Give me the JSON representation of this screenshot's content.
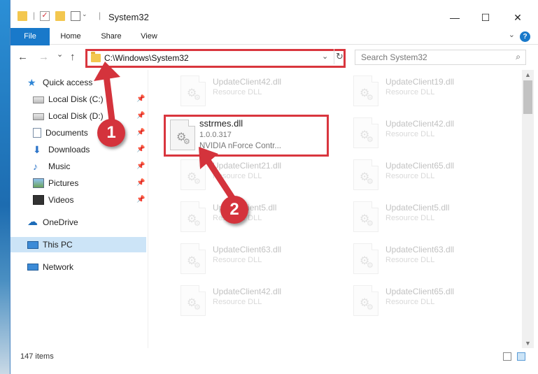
{
  "window": {
    "title": "System32",
    "controls": {
      "minimize": "—",
      "maximize": "☐",
      "close": "✕"
    }
  },
  "ribbon": {
    "tabs": [
      "File",
      "Home",
      "Share",
      "View"
    ],
    "help": "?"
  },
  "navigation": {
    "back_icon": "←",
    "forward_icon": "→",
    "recent_icon": "⌄",
    "up_icon": "↑",
    "address_path": "C:\\Windows\\System32",
    "search_placeholder": "Search System32"
  },
  "sidebar": {
    "items": [
      {
        "label": "Quick access",
        "icon": "star-icon",
        "pinned": false
      },
      {
        "label": "Local Disk (C:)",
        "icon": "disk-icon",
        "pinned": true
      },
      {
        "label": "Local Disk (D:)",
        "icon": "disk-icon",
        "pinned": true
      },
      {
        "label": "Documents",
        "icon": "documents-icon",
        "pinned": true
      },
      {
        "label": "Downloads",
        "icon": "downloads-icon",
        "pinned": true
      },
      {
        "label": "Music",
        "icon": "music-icon",
        "pinned": true
      },
      {
        "label": "Pictures",
        "icon": "pictures-icon",
        "pinned": true
      },
      {
        "label": "Videos",
        "icon": "videos-icon",
        "pinned": true
      },
      {
        "label": "OneDrive",
        "icon": "onedrive-icon",
        "pinned": false
      },
      {
        "label": "This PC",
        "icon": "this-pc-icon",
        "pinned": false,
        "selected": true
      },
      {
        "label": "Network",
        "icon": "network-icon",
        "pinned": false
      }
    ]
  },
  "files": {
    "highlighted": {
      "name": "sstrmes.dll",
      "version": "1.0.0.317",
      "description": "NVIDIA nForce Contr..."
    },
    "left_column": [
      {
        "name": "UpdateClient42.dll",
        "type": "Resource DLL"
      },
      {
        "name": "UpdateClient21.dll",
        "type": "Resource DLL"
      },
      {
        "name": "UpdateClient5.dll",
        "type": "Resource DLL"
      },
      {
        "name": "UpdateClient63.dll",
        "type": "Resource DLL"
      },
      {
        "name": "UpdateClient42.dll",
        "type": "Resource DLL"
      }
    ],
    "right_column": [
      {
        "name": "UpdateClient19.dll",
        "type": "Resource DLL"
      },
      {
        "name": "UpdateClient42.dll",
        "type": "Resource DLL"
      },
      {
        "name": "UpdateClient65.dll",
        "type": "Resource DLL"
      },
      {
        "name": "UpdateClient5.dll",
        "type": "Resource DLL"
      },
      {
        "name": "UpdateClient63.dll",
        "type": "Resource DLL"
      },
      {
        "name": "UpdateClient65.dll",
        "type": "Resource DLL"
      }
    ]
  },
  "status": {
    "item_count": "147 items"
  },
  "annotations": {
    "step1": "1",
    "step2": "2"
  },
  "colors": {
    "accent": "#1979ca",
    "highlight_red": "#d9363e",
    "badge_red": "#d4333c",
    "selected_bg": "#cce4f7"
  }
}
